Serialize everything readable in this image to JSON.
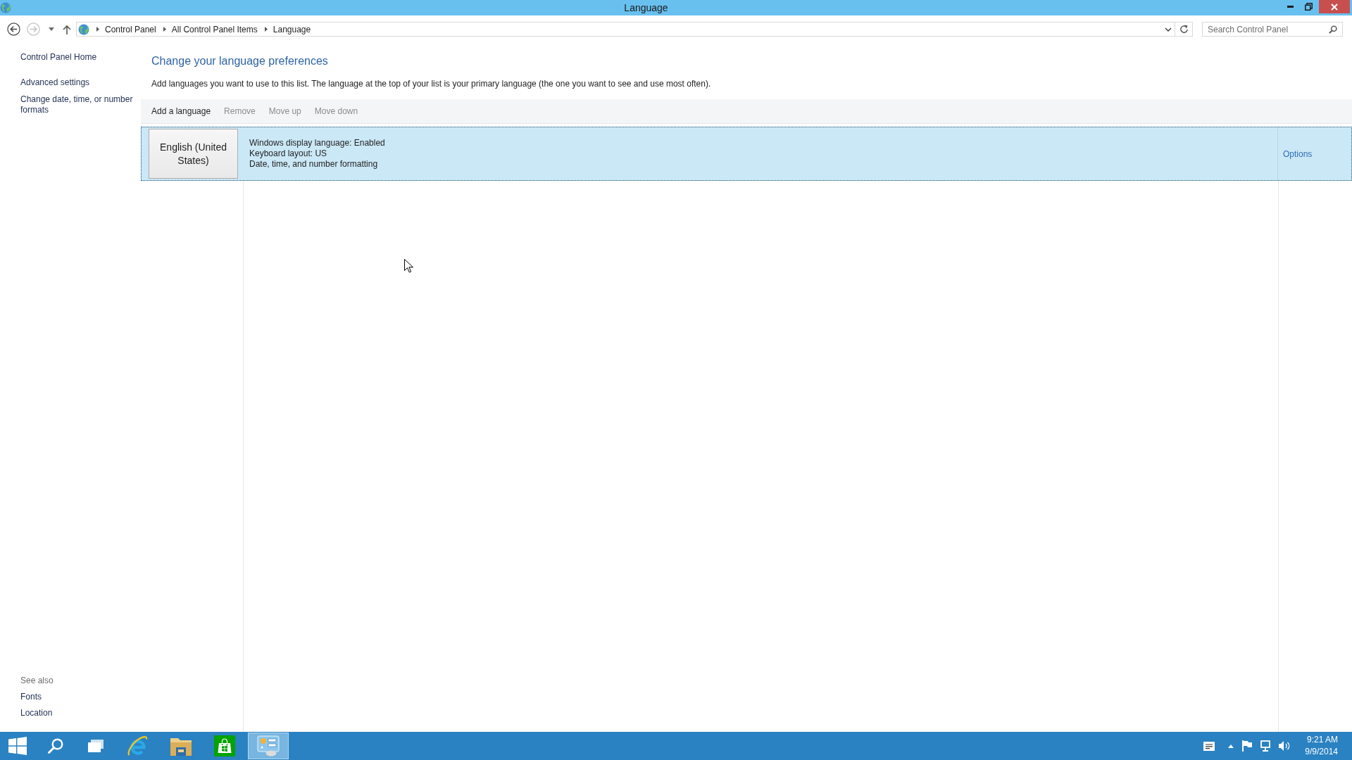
{
  "window": {
    "title": "Language"
  },
  "navigation": {
    "back": {
      "disabled": false
    },
    "forward": {
      "disabled": true
    }
  },
  "address_bar": {
    "breadcrumbs": [
      "Control Panel",
      "All Control Panel Items",
      "Language"
    ]
  },
  "search": {
    "placeholder": "Search Control Panel"
  },
  "sidebar": {
    "links": [
      "Control Panel Home",
      "Advanced settings",
      "Change date, time, or number formats"
    ],
    "see_also": {
      "heading": "See also",
      "links": [
        "Fonts",
        "Location"
      ]
    }
  },
  "main": {
    "title": "Change your language preferences",
    "description": "Add languages you want to use to this list. The language at the top of your list is your primary language (the one you want to see and use most often).",
    "toolbar": [
      {
        "label": "Add a language",
        "disabled": false
      },
      {
        "label": "Remove",
        "disabled": true
      },
      {
        "label": "Move up",
        "disabled": true
      },
      {
        "label": "Move down",
        "disabled": true
      }
    ],
    "languages": [
      {
        "name": "English (United States)",
        "details": [
          "Windows display language: Enabled",
          "Keyboard layout: US",
          "Date, time, and number formatting"
        ],
        "options": "Options",
        "selected": true
      }
    ]
  },
  "taskbar": {
    "buttons": [
      {
        "kind": "start"
      },
      {
        "kind": "search"
      },
      {
        "kind": "task-view"
      }
    ],
    "apps": [
      {
        "kind": "browser",
        "active": false
      },
      {
        "kind": "folder",
        "active": false
      },
      {
        "kind": "store",
        "active": false
      },
      {
        "kind": "control-panel",
        "active": true
      }
    ],
    "tray": [
      {
        "kind": "message"
      },
      {
        "kind": "chevron"
      },
      {
        "kind": "flag"
      },
      {
        "kind": "network"
      },
      {
        "kind": "volume"
      }
    ],
    "clock": {
      "time": "9:21 AM",
      "date": "9/9/2014"
    }
  }
}
